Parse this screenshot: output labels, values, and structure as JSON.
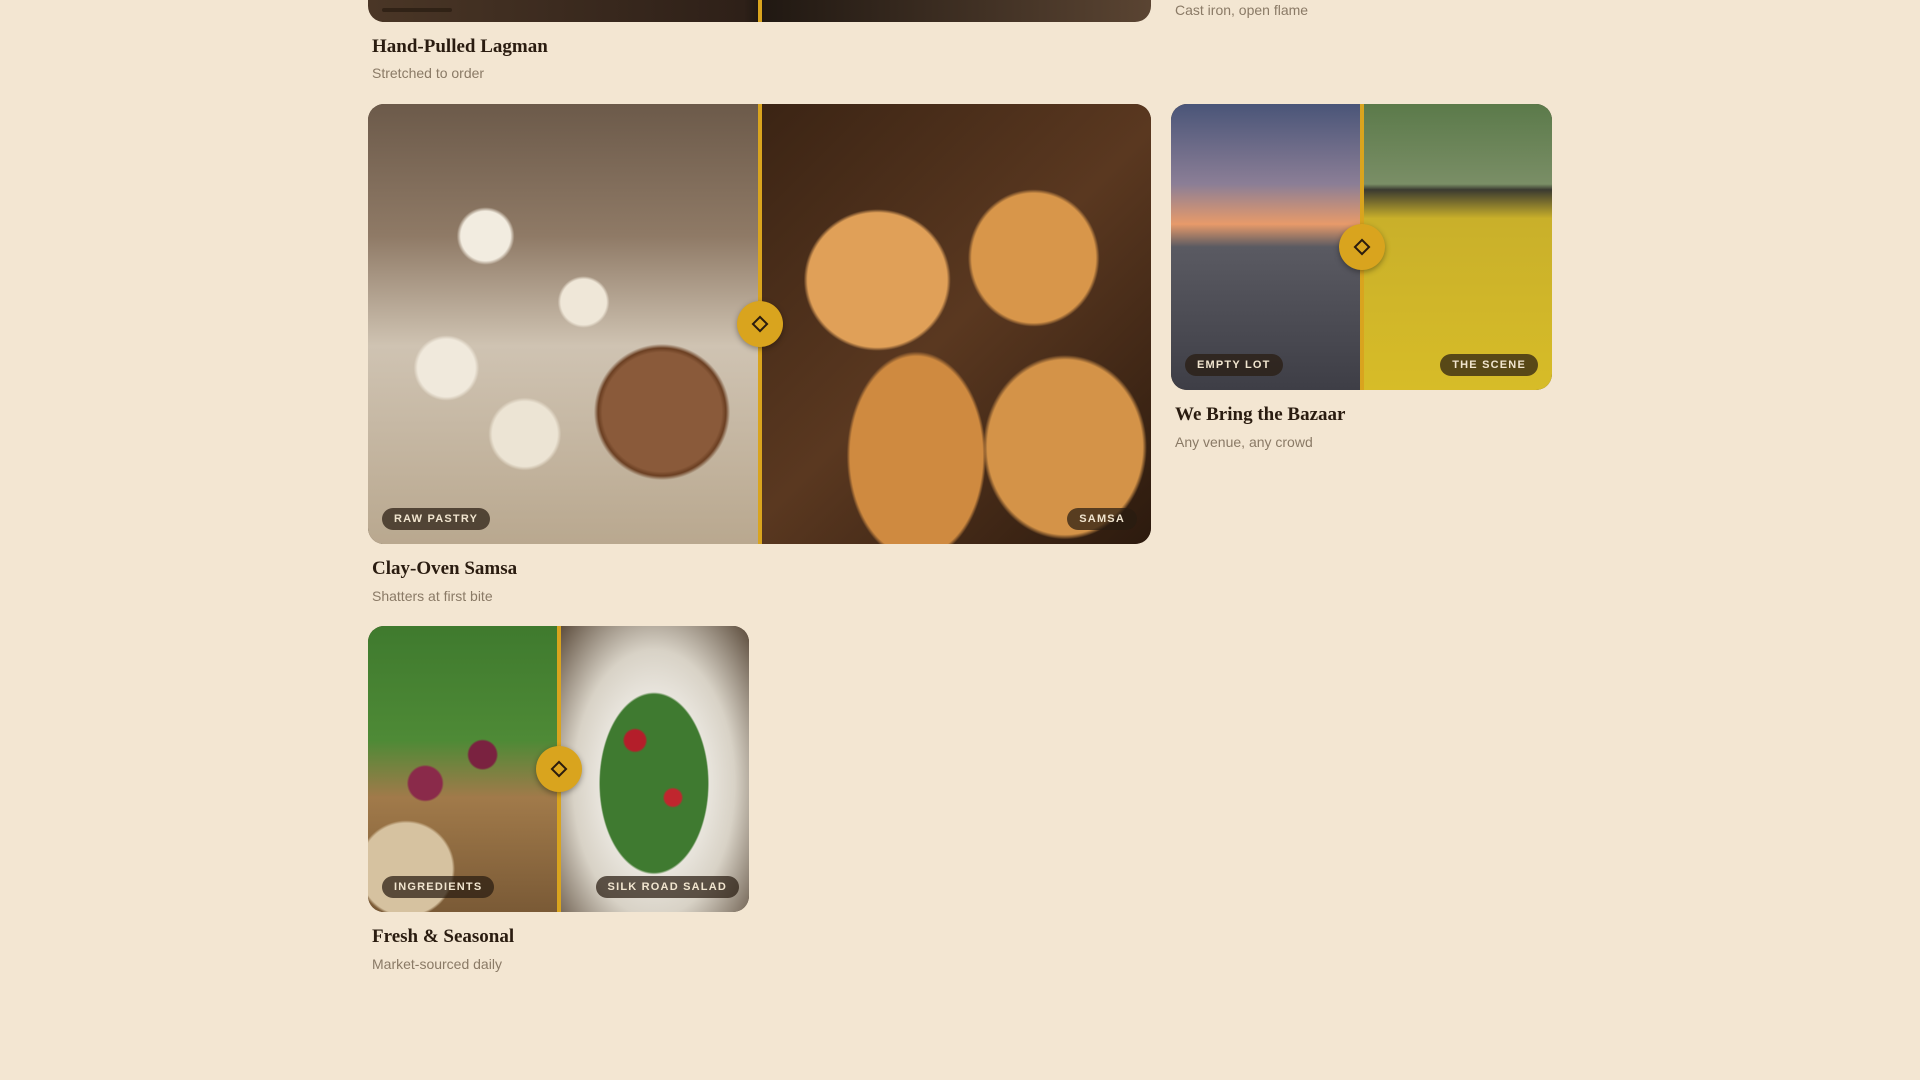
{
  "cards": [
    {
      "title": "Hand-Pulled Lagman",
      "subtitle": "Stretched to order",
      "left_tag": "",
      "right_tag": ""
    },
    {
      "title": "",
      "subtitle": "Cast iron, open flame"
    },
    {
      "title": "Clay-Oven Samsa",
      "subtitle": "Shatters at first bite",
      "left_tag": "RAW PASTRY",
      "right_tag": "SAMSA",
      "left_image": "dough-balls-and-filling-photo",
      "right_image": "baked-samsa-photo",
      "reveal": 0.5
    },
    {
      "title": "We Bring the Bazaar",
      "subtitle": "Any venue, any crowd",
      "left_tag": "EMPTY LOT",
      "right_tag": "THE SCENE",
      "left_image": "empty-lot-sunset-photo",
      "right_image": "food-truck-scene-photo",
      "reveal": 0.5
    },
    {
      "title": "Fresh & Seasonal",
      "subtitle": "Market-sourced daily",
      "left_tag": "INGREDIENTS",
      "right_tag": "SILK ROAD SALAD",
      "left_image": "raw-vegetables-photo",
      "right_image": "salad-photo",
      "reveal": 0.5
    }
  ],
  "colors": {
    "background": "#f3e6d2",
    "accent": "#d9a41e",
    "title": "#2a1c10",
    "subtitle": "#8a7a66"
  },
  "icons": {
    "slider_handle": "diamond-icon"
  }
}
